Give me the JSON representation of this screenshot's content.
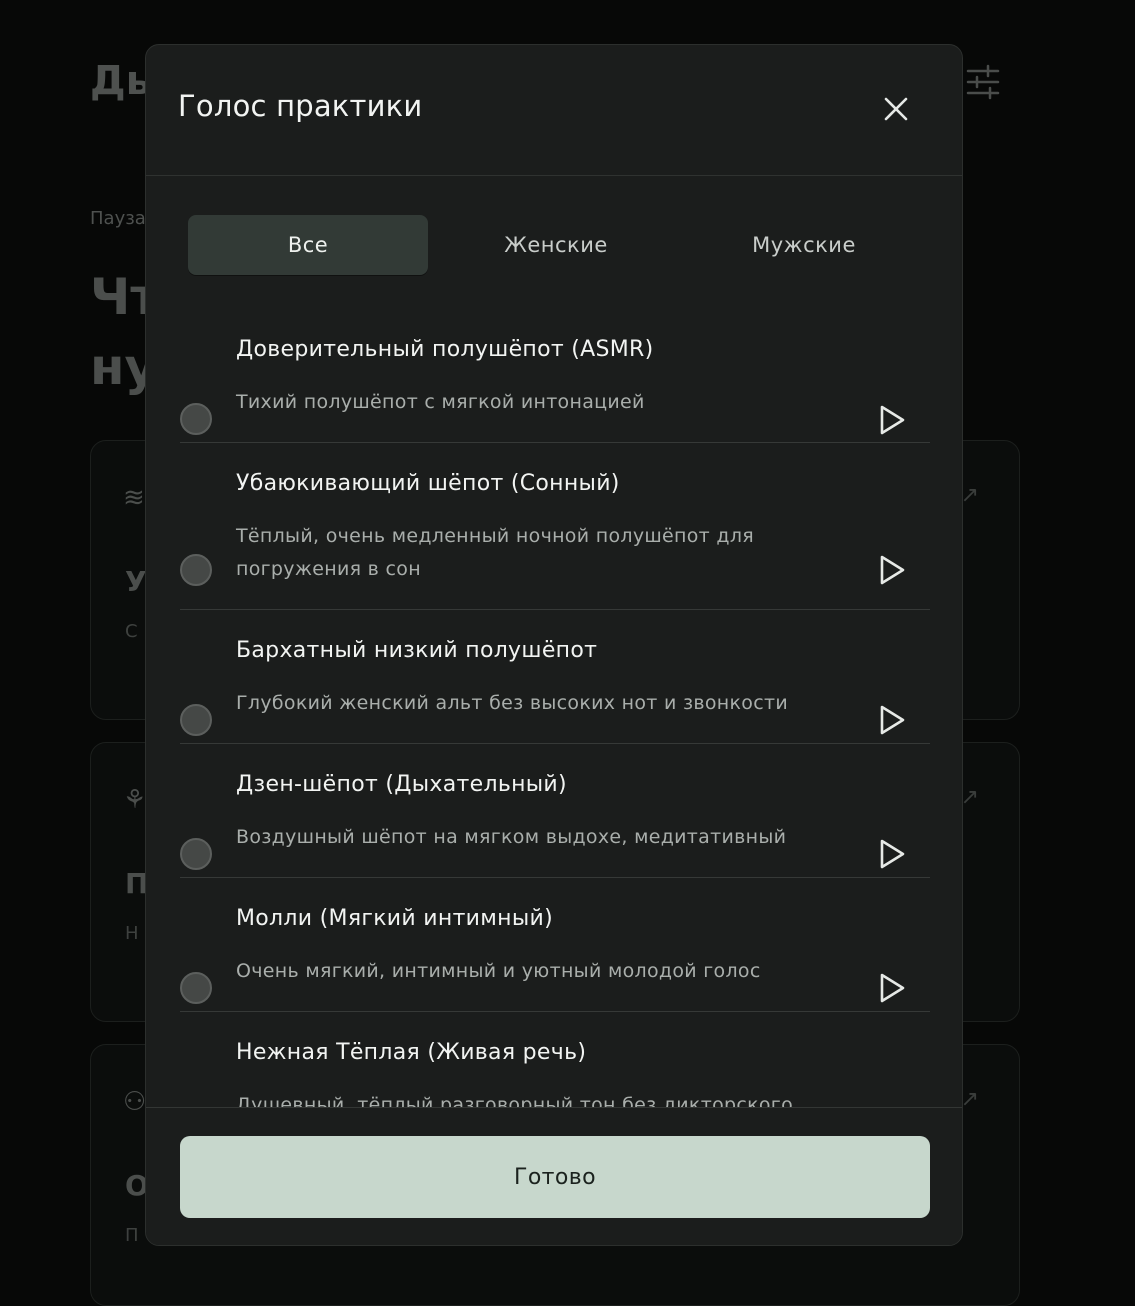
{
  "background": {
    "title": "Ды",
    "label": "Пауза",
    "heading_line1": "Чт",
    "heading_line2": "ну",
    "cards": [
      {
        "icon": "≋",
        "title": "У",
        "sub": "С"
      },
      {
        "icon": "⚘",
        "title": "П",
        "sub": "Н"
      },
      {
        "icon": "⚇",
        "title": "О",
        "sub": "П"
      }
    ]
  },
  "modal": {
    "title": "Голос практики",
    "tabs": [
      {
        "label": "Все",
        "active": true
      },
      {
        "label": "Женские",
        "active": false
      },
      {
        "label": "Мужские",
        "active": false
      }
    ],
    "voices": [
      {
        "name": "Доверительный полушёпот (ASMR)",
        "desc": "Тихий полушёпот с мягкой интонацией"
      },
      {
        "name": "Убаюкивающий шёпот (Сонный)",
        "desc": "Тёплый, очень медленный ночной полушёпот для погружения в сон"
      },
      {
        "name": "Бархатный низкий полушёпот",
        "desc": "Глубокий женский альт без высоких нот и звонкости"
      },
      {
        "name": "Дзен-шёпот (Дыхательный)",
        "desc": "Воздушный шёпот на мягком выдохе, медитативный"
      },
      {
        "name": "Молли (Мягкий интимный)",
        "desc": "Очень мягкий, интимный и уютный молодой голос"
      },
      {
        "name": "Нежная Тёплая (Живая речь)",
        "desc": "Душевный, тёплый разговорный тон без дикторского"
      }
    ],
    "done_label": "Готово"
  },
  "icons": {
    "close": "close-icon",
    "play": "play-icon",
    "filter": "sliders-icon"
  }
}
